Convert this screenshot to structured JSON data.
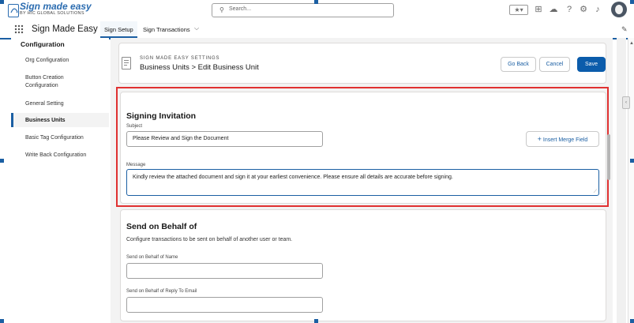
{
  "header": {
    "logo_title": "Sign made easy",
    "logo_subtitle": "BY HIC GLOBAL SOLUTIONS",
    "search_placeholder": "Search..."
  },
  "nav": {
    "app_name": "Sign Made Easy",
    "tabs": [
      {
        "label": "Sign Setup",
        "active": true
      },
      {
        "label": "Sign Transactions",
        "active": false
      }
    ]
  },
  "sidebar": {
    "heading": "Configuration",
    "items": [
      {
        "label": "Org Configuration"
      },
      {
        "label": "Button Creation Configuration"
      },
      {
        "label": "General Setting"
      },
      {
        "label": "Business Units",
        "active": true
      },
      {
        "label": "Basic Tag Configuration"
      },
      {
        "label": "Write Back Configuration"
      }
    ]
  },
  "page": {
    "eyebrow": "SIGN MADE EASY SETTINGS",
    "title": "Business Units > Edit Business Unit",
    "go_back": "Go Back",
    "cancel": "Cancel",
    "save": "Save"
  },
  "signing": {
    "heading": "Signing Invitation",
    "subject_label": "Subject",
    "subject_value": "Please Review and Sign the Document",
    "insert_merge": "Insert Merge Field",
    "message_label": "Message",
    "message_value": "Kindly review the attached document and sign it at your earliest convenience. Please ensure all details are accurate before signing."
  },
  "behalf": {
    "heading": "Send on Behalf of",
    "description": "Configure transactions to be sent on behalf of another user or team.",
    "name_label": "Send on Behalf of Name",
    "email_label": "Send on Behalf of Reply To Email"
  },
  "colors": {
    "brand": "#1b5fa3",
    "highlight": "#e03131"
  }
}
